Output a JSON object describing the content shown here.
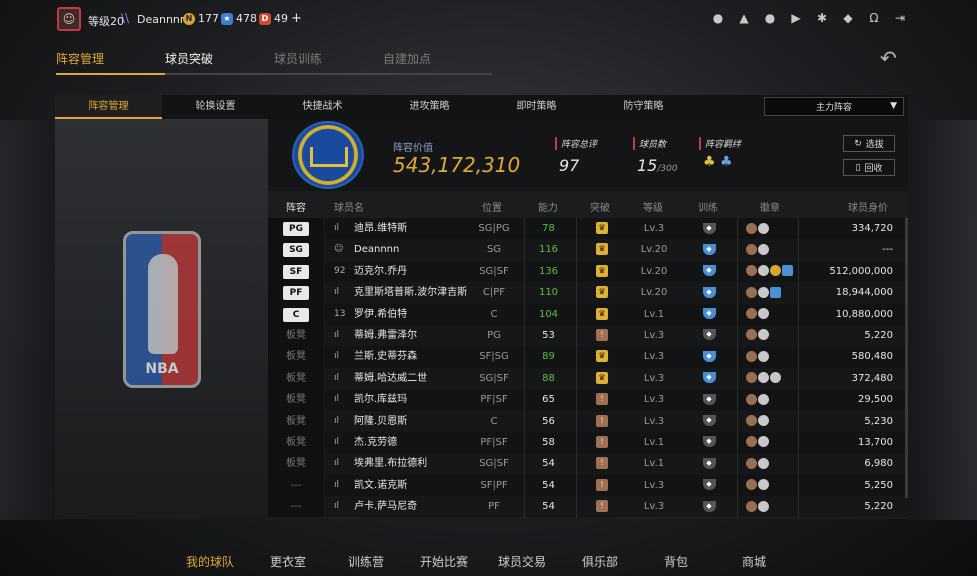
{
  "header": {
    "level": "等级20",
    "username": "Deannnn",
    "currencies": [
      {
        "icon": "gold-coin-icon",
        "value": "177"
      },
      {
        "icon": "star-coin-icon",
        "value": "478"
      },
      {
        "icon": "d-coin-icon",
        "value": "49"
      }
    ],
    "plus": "+"
  },
  "main_tabs": [
    "阵容管理",
    "球员突破",
    "球员训练",
    "自建加点"
  ],
  "sub_tabs": [
    "阵容管理",
    "轮换设置",
    "快捷战术",
    "进攻策略",
    "即时策略",
    "防守策略"
  ],
  "lineup_select": "主力阵容",
  "team_info": {
    "value_label": "阵容价值",
    "value": "543,172,310",
    "rating_label": "阵容总评",
    "rating": "97",
    "players_label": "球员数",
    "players": "15",
    "players_max": "/300",
    "bond_label": "阵容羁绊",
    "select_btn": "选拔",
    "recycle_btn": "回收"
  },
  "table": {
    "headers": [
      "阵容",
      "球员名",
      "位置",
      "能力",
      "突破",
      "等级",
      "训练",
      "徽章",
      "球员身价"
    ],
    "rows": [
      {
        "slot": "PG",
        "starter": true,
        "mark": "signal",
        "name": "迪昂.维特斯",
        "pos": "SG|PG",
        "ovr": "78",
        "ovr_green": true,
        "brk": "gold",
        "lvl": "Lv.3",
        "trn": "grey",
        "badges": [
          "bronze",
          "silver"
        ],
        "price": "334,720"
      },
      {
        "slot": "SG",
        "starter": true,
        "mark": "user",
        "name": "Deannnn",
        "pos": "SG",
        "ovr": "116",
        "ovr_green": true,
        "brk": "gold",
        "lvl": "Lv.20",
        "trn": "blue",
        "badges": [
          "bronze",
          "silver"
        ],
        "price": "---"
      },
      {
        "slot": "SF",
        "starter": true,
        "mark": "92",
        "name": "迈克尔.乔丹",
        "pos": "SG|SF",
        "ovr": "136",
        "ovr_green": true,
        "brk": "gold",
        "lvl": "Lv.20",
        "trn": "blue",
        "badges": [
          "bronze",
          "silver",
          "gold",
          "blue"
        ],
        "price": "512,000,000"
      },
      {
        "slot": "PF",
        "starter": true,
        "mark": "signal",
        "name": "克里斯塔普斯.波尔津吉斯",
        "pos": "C|PF",
        "ovr": "110",
        "ovr_green": true,
        "brk": "gold",
        "lvl": "Lv.20",
        "trn": "blue",
        "badges": [
          "bronze",
          "silver",
          "blue"
        ],
        "price": "18,944,000"
      },
      {
        "slot": "C",
        "starter": true,
        "mark": "13",
        "name": "罗伊.希伯特",
        "pos": "C",
        "ovr": "104",
        "ovr_green": true,
        "brk": "gold",
        "lvl": "Lv.1",
        "trn": "blue",
        "badges": [
          "bronze",
          "silver"
        ],
        "price": "10,880,000"
      },
      {
        "slot": "板凳",
        "starter": false,
        "mark": "signal",
        "name": "蒂姆.弗雷泽尔",
        "pos": "PG",
        "ovr": "53",
        "ovr_green": false,
        "brk": "bronze",
        "lvl": "Lv.3",
        "trn": "grey",
        "badges": [
          "bronze",
          "silver"
        ],
        "price": "5,220"
      },
      {
        "slot": "板凳",
        "starter": false,
        "mark": "signal",
        "name": "兰斯.史蒂芬森",
        "pos": "SF|SG",
        "ovr": "89",
        "ovr_green": true,
        "brk": "gold",
        "lvl": "Lv.3",
        "trn": "blue",
        "badges": [
          "bronze",
          "silver"
        ],
        "price": "580,480"
      },
      {
        "slot": "板凳",
        "starter": false,
        "mark": "signal",
        "name": "蒂姆.哈达威二世",
        "pos": "SG|SF",
        "ovr": "88",
        "ovr_green": true,
        "brk": "gold",
        "lvl": "Lv.3",
        "trn": "blue",
        "badges": [
          "bronze",
          "silver",
          "silver"
        ],
        "price": "372,480"
      },
      {
        "slot": "板凳",
        "starter": false,
        "mark": "signal",
        "name": "凯尔.库兹玛",
        "pos": "PF|SF",
        "ovr": "65",
        "ovr_green": false,
        "brk": "bronze",
        "lvl": "Lv.3",
        "trn": "grey",
        "badges": [
          "bronze",
          "silver"
        ],
        "price": "29,500"
      },
      {
        "slot": "板凳",
        "starter": false,
        "mark": "signal",
        "name": "阿隆.贝恩斯",
        "pos": "C",
        "ovr": "56",
        "ovr_green": false,
        "brk": "bronze",
        "lvl": "Lv.3",
        "trn": "grey",
        "badges": [
          "bronze",
          "silver"
        ],
        "price": "5,230"
      },
      {
        "slot": "板凳",
        "starter": false,
        "mark": "signal",
        "name": "杰.克劳德",
        "pos": "PF|SF",
        "ovr": "58",
        "ovr_green": false,
        "brk": "bronze",
        "lvl": "Lv.1",
        "trn": "grey",
        "badges": [
          "bronze",
          "silver"
        ],
        "price": "13,700"
      },
      {
        "slot": "板凳",
        "starter": false,
        "mark": "signal",
        "name": "埃弗里.布拉德利",
        "pos": "SG|SF",
        "ovr": "54",
        "ovr_green": false,
        "brk": "bronze",
        "lvl": "Lv.1",
        "trn": "grey",
        "badges": [
          "bronze",
          "silver"
        ],
        "price": "6,980"
      },
      {
        "slot": "---",
        "starter": false,
        "mark": "signal",
        "name": "凯文.诺克斯",
        "pos": "SF|PF",
        "ovr": "54",
        "ovr_green": false,
        "brk": "bronze",
        "lvl": "Lv.3",
        "trn": "grey",
        "badges": [
          "bronze",
          "silver"
        ],
        "price": "5,250"
      },
      {
        "slot": "---",
        "starter": false,
        "mark": "signal",
        "name": "卢卡.萨马尼奇",
        "pos": "PF",
        "ovr": "54",
        "ovr_green": false,
        "brk": "bronze",
        "lvl": "Lv.3",
        "trn": "grey",
        "badges": [
          "bronze",
          "silver"
        ],
        "price": "5,220"
      }
    ]
  },
  "bottom_nav": [
    "我的球队",
    "更衣室",
    "训练营",
    "开始比赛",
    "球员交易",
    "俱乐部",
    "背包",
    "商城"
  ],
  "colors": {
    "accent": "#e0a838",
    "green": "#5cbf3a",
    "red": "#c83a3a"
  }
}
